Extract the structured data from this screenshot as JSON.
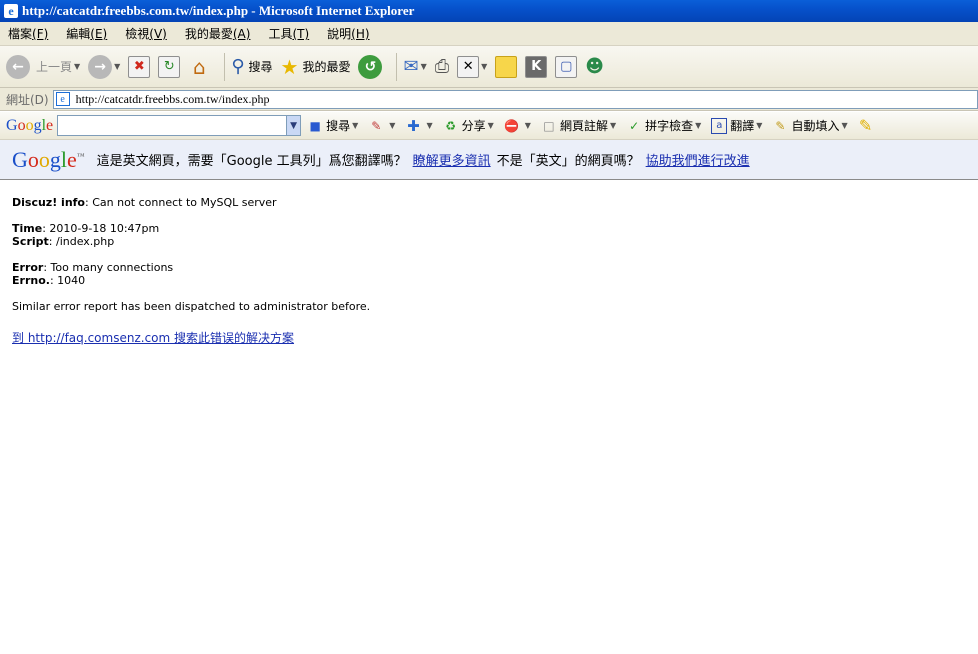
{
  "window": {
    "title": "http://catcatdr.freebbs.com.tw/index.php - Microsoft Internet Explorer",
    "logo_glyph": "e"
  },
  "menu": {
    "items": [
      {
        "label": "檔案",
        "key": "(F)"
      },
      {
        "label": "編輯",
        "key": "(E)"
      },
      {
        "label": "檢視",
        "key": "(V)"
      },
      {
        "label": "我的最愛",
        "key": "(A)"
      },
      {
        "label": "工具",
        "key": "(T)"
      },
      {
        "label": "說明",
        "key": "(H)"
      }
    ]
  },
  "toolbar": {
    "back_label": "上一頁",
    "search_label": "搜尋",
    "favorites_label": "我的最愛"
  },
  "address": {
    "label": "網址(D)",
    "url": "http://catcatdr.freebbs.com.tw/index.php"
  },
  "google_toolbar": {
    "logo": [
      "G",
      "o",
      "o",
      "g",
      "l",
      "e"
    ],
    "search_label": "搜尋",
    "share_label": "分享",
    "annotate_label": "網頁註解",
    "spellcheck_label": "拼字檢查",
    "translate_label": "翻譯",
    "autofill_label": "自動填入"
  },
  "translate_bar": {
    "logo": [
      "G",
      "o",
      "o",
      "g",
      "l",
      "e"
    ],
    "tm": "™",
    "prompt": "這是英文網頁，需要「Google 工具列」爲您翻譯嗎？",
    "more_info_link": "瞭解更多資訊",
    "not_english": "不是「英文」的網頁嗎？",
    "help_link": "協助我們進行改進"
  },
  "page": {
    "info_label": "Discuz! info",
    "info_text": ": Can not connect to MySQL server",
    "time_label": "Time",
    "time_value": ": 2010-9-18 10:47pm",
    "script_label": "Script",
    "script_value": ": /index.php",
    "error_label": "Error",
    "error_value": ": Too many connections",
    "errno_label": "Errno.",
    "errno_value": ": 1040",
    "similar_text": "Similar error report has been dispatched to administrator before.",
    "faq_link": "到 http://faq.comsenz.com 搜索此错误的解决方案"
  }
}
